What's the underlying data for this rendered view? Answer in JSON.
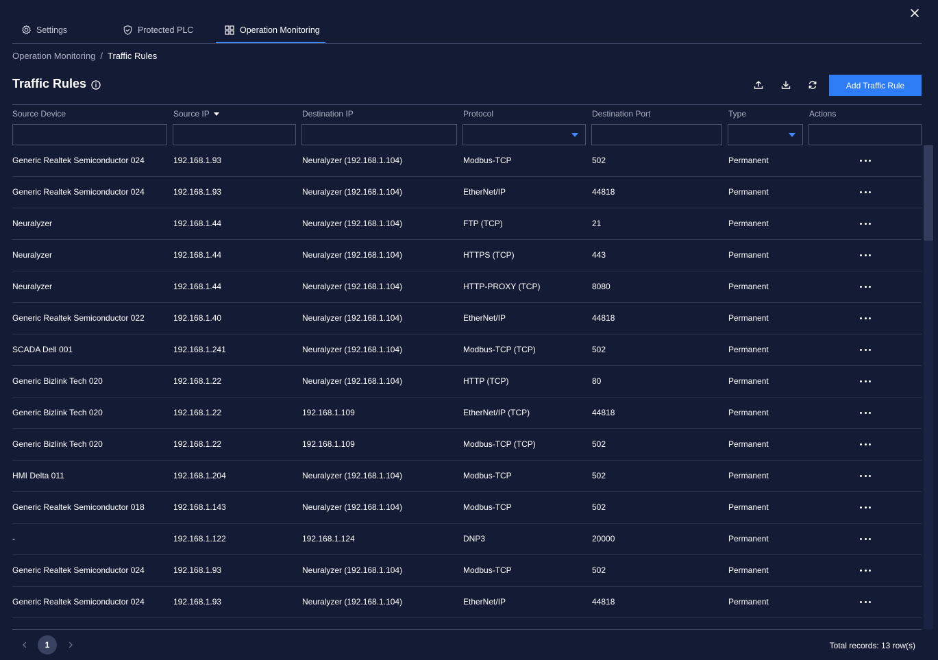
{
  "tabs": [
    {
      "label": "Settings",
      "icon": "gear-icon"
    },
    {
      "label": "Protected PLC",
      "icon": "shield-icon"
    },
    {
      "label": "Operation Monitoring",
      "icon": "dashboard-icon",
      "active": true
    }
  ],
  "breadcrumb": {
    "parent": "Operation Monitoring",
    "separator": "/",
    "current": "Traffic Rules"
  },
  "page": {
    "title": "Traffic Rules"
  },
  "toolbar": {
    "add_label": "Add Traffic Rule",
    "icons": [
      "upload-icon",
      "download-icon",
      "refresh-icon"
    ]
  },
  "columns": {
    "source_device": "Source Device",
    "source_ip": "Source IP",
    "destination_ip": "Destination IP",
    "protocol": "Protocol",
    "destination_port": "Destination Port",
    "type": "Type",
    "actions": "Actions"
  },
  "rows": [
    {
      "source_device": "Generic Realtek Semiconductor 024",
      "source_ip": "192.168.1.93",
      "destination_ip": "Neuralyzer (192.168.1.104)",
      "protocol": "Modbus-TCP",
      "destination_port": "502",
      "type": "Permanent"
    },
    {
      "source_device": "Generic Realtek Semiconductor 024",
      "source_ip": "192.168.1.93",
      "destination_ip": "Neuralyzer (192.168.1.104)",
      "protocol": "EtherNet/IP",
      "destination_port": "44818",
      "type": "Permanent"
    },
    {
      "source_device": "Neuralyzer",
      "source_ip": "192.168.1.44",
      "destination_ip": "Neuralyzer (192.168.1.104)",
      "protocol": "FTP (TCP)",
      "destination_port": "21",
      "type": "Permanent"
    },
    {
      "source_device": "Neuralyzer",
      "source_ip": "192.168.1.44",
      "destination_ip": "Neuralyzer (192.168.1.104)",
      "protocol": "HTTPS (TCP)",
      "destination_port": "443",
      "type": "Permanent"
    },
    {
      "source_device": "Neuralyzer",
      "source_ip": "192.168.1.44",
      "destination_ip": "Neuralyzer (192.168.1.104)",
      "protocol": "HTTP-PROXY (TCP)",
      "destination_port": "8080",
      "type": "Permanent"
    },
    {
      "source_device": "Generic Realtek Semiconductor 022",
      "source_ip": "192.168.1.40",
      "destination_ip": "Neuralyzer (192.168.1.104)",
      "protocol": "EtherNet/IP",
      "destination_port": "44818",
      "type": "Permanent"
    },
    {
      "source_device": "SCADA Dell 001",
      "source_ip": "192.168.1.241",
      "destination_ip": "Neuralyzer (192.168.1.104)",
      "protocol": "Modbus-TCP (TCP)",
      "destination_port": "502",
      "type": "Permanent"
    },
    {
      "source_device": "Generic Bizlink Tech 020",
      "source_ip": "192.168.1.22",
      "destination_ip": "Neuralyzer (192.168.1.104)",
      "protocol": "HTTP (TCP)",
      "destination_port": "80",
      "type": "Permanent"
    },
    {
      "source_device": "Generic Bizlink Tech 020",
      "source_ip": "192.168.1.22",
      "destination_ip": "192.168.1.109",
      "protocol": "EtherNet/IP (TCP)",
      "destination_port": "44818",
      "type": "Permanent"
    },
    {
      "source_device": "Generic Bizlink Tech 020",
      "source_ip": "192.168.1.22",
      "destination_ip": "192.168.1.109",
      "protocol": "Modbus-TCP (TCP)",
      "destination_port": "502",
      "type": "Permanent"
    },
    {
      "source_device": "HMI Delta 011",
      "source_ip": "192.168.1.204",
      "destination_ip": "Neuralyzer (192.168.1.104)",
      "protocol": "Modbus-TCP",
      "destination_port": "502",
      "type": "Permanent"
    },
    {
      "source_device": "Generic Realtek Semiconductor 018",
      "source_ip": "192.168.1.143",
      "destination_ip": "Neuralyzer (192.168.1.104)",
      "protocol": "Modbus-TCP",
      "destination_port": "502",
      "type": "Permanent"
    },
    {
      "source_device": "-",
      "source_ip": "192.168.1.122",
      "destination_ip": "192.168.1.124",
      "protocol": "DNP3",
      "destination_port": "20000",
      "type": "Permanent"
    },
    {
      "source_device": "Generic Realtek Semiconductor 024",
      "source_ip": "192.168.1.93",
      "destination_ip": "Neuralyzer (192.168.1.104)",
      "protocol": "Modbus-TCP",
      "destination_port": "502",
      "type": "Permanent"
    },
    {
      "source_device": "Generic Realtek Semiconductor 024",
      "source_ip": "192.168.1.93",
      "destination_ip": "Neuralyzer (192.168.1.104)",
      "protocol": "EtherNet/IP",
      "destination_port": "44818",
      "type": "Permanent"
    }
  ],
  "pagination": {
    "current_page": "1",
    "total": "Total records: 13 row(s)"
  },
  "colors": {
    "background": "#141b34",
    "accent": "#2f7df6",
    "border": "#3a4261"
  }
}
